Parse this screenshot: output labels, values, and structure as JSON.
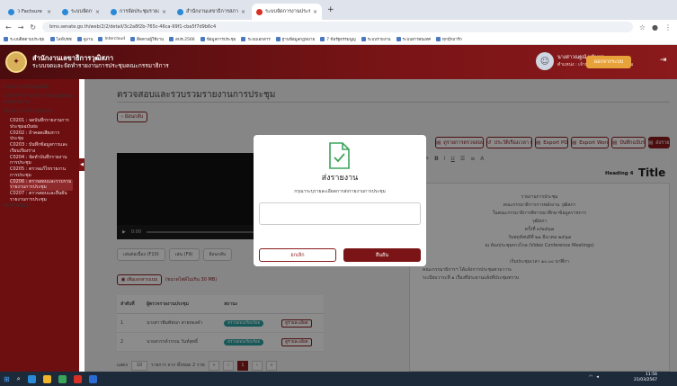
{
  "browser": {
    "tabs": [
      {
        "label": "ว Factsure",
        "color": "#2a8ad8"
      },
      {
        "label": "ระบบจัดการงานสำนักงาน ส่วน...",
        "color": "#2a8ad8"
      },
      {
        "label": "การจัดประชุมรายงานสำนักงาน",
        "color": "#2a8ad8"
      },
      {
        "label": "สำนักงานเลขาธิการสภาฯ",
        "color": "#2a8ad8"
      },
      {
        "label": "ระบบจัดการงานประชุม",
        "color": "#d93025"
      }
    ],
    "url": "bms.senate.go.th/web/2/2/detail/3c2a8f2b-765c-46ca-99f1-cba5f7d9b6c4",
    "bookmarks": [
      "ระบบติดตามประชุม",
      "ไลฟ์ปชช",
      "ดูงาน",
      "Intercloud",
      "ติดตามผู้ใช้งาน",
      "สปช.2566",
      "ข้อมูลการประชุม",
      "ระบบเอกสาร",
      "ฐานข้อมูลกฎหมาย",
      "7 ข้อรัฐธรรมนูญ",
      "ระบบรายงาน",
      "ระบบสารสนเทศ",
      "ทุกบุ๊กมาร์ก"
    ]
  },
  "header": {
    "org_line1": "สำนักงานเลขาธิการวุฒิสภา",
    "org_line2": "ระบบจดและจัดทำรายงานการประชุมคณะกรรมาธิการ",
    "user_name": "นางสาวณฐณ์ นพินทร",
    "user_role": "ตำแหน่ง : เจ้าหน้าที่รายงานการประชุม",
    "logout_label": "ออกจากระบบ"
  },
  "sidebar": {
    "items": [
      {
        "label": "การควบคุมข้อมูลหลัก",
        "type": "item"
      },
      {
        "label": "การจัดทำรายงานการประชุมคณะกรรมาธิการ",
        "type": "item"
      },
      {
        "label": "ขั้นตอนการดำเนินงาน",
        "type": "group"
      },
      {
        "label": "C0201 : จดบันทึกรายงานการประชุมฉบับย่อ",
        "type": "sub"
      },
      {
        "label": "C0202 : ถ้าคอดเสียงการประชุม",
        "type": "sub"
      },
      {
        "label": "C0203 : บันทึกข้อมูลการและเรียบเรียงร่าง",
        "type": "sub"
      },
      {
        "label": "C0204 : จัดทำบันทึกรายงานการประชุม",
        "type": "sub"
      },
      {
        "label": "C0205 : ตรวจแก้ไขรายงานการประชุม",
        "type": "sub"
      },
      {
        "label": "C0206 : ตรวจสอบและรวบรวมรายงานการประชุม",
        "type": "sub",
        "active": true
      },
      {
        "label": "C0207 : ตรวจสอบและยืนยันรายงานการประชุม",
        "type": "sub"
      },
      {
        "label": "จัดทำข้อมูล",
        "type": "item"
      }
    ]
  },
  "main": {
    "page_title": "ตรวจสอบและรวบรวมรายงานการประชุม",
    "back_label": "ย้อนกลับ",
    "toolbar": [
      {
        "label": "ดูรายการตรวจสอบ",
        "icon": "document-icon",
        "style": "outline"
      },
      {
        "label": "ประวัติเรื่องเวลา (5)",
        "icon": "history-icon",
        "style": "outline"
      },
      {
        "label": "Export PDF",
        "icon": "pdf-icon",
        "style": "outline"
      },
      {
        "label": "Export Word",
        "icon": "word-icon",
        "style": "outline"
      },
      {
        "label": "บันทึกฉบับร่าง",
        "icon": "save-icon",
        "style": "outline"
      },
      {
        "label": "ส่งรายงาน",
        "icon": "send-icon",
        "style": "filled"
      }
    ],
    "video_time": "0:00",
    "audio_buttons": [
      "เล่นต่อเนื่อง (F10)",
      "เล่น (F9)",
      "ย้อนกลับ"
    ],
    "add_file_label": "เพิ่มเอกสารแนบ",
    "file_hint": "(ขนาดไฟล์ไม่เกิน 30 MB)",
    "file_table": {
      "headers": [
        "ลำดับที่",
        "ผู้ตรวจรายงานประชุม",
        "สถานะ"
      ],
      "rows": [
        {
          "no": "1",
          "name": "นางสาวพิมพ์ชนก สายทองคำ",
          "status": "ตรวจสอบเรียบร้อย",
          "action": "ดูรายละเอียด"
        },
        {
          "no": "2",
          "name": "นายสวรรค์วรรณ วันท์สุทธิ์",
          "status": "ตรวจสอบเรียบร้อย",
          "action": "ดูรายละเอียด"
        }
      ]
    },
    "pager": {
      "page_size_label": "แสดง",
      "page_size": "10",
      "summary": "รายการ จาก ทั้งหมด 2 รายการ",
      "current_page": "1"
    }
  },
  "editor": {
    "heading_style": "Heading 4",
    "title_style": "Title",
    "doc_lines": [
      "รายงานการประชุม",
      "คณะกรรมาธิการการพลังงาน วุฒิสภา",
      "ในคณะกรรมาธิการพิจารณาศึกษาข้อมูลราชการ",
      "วุฒิสภา",
      "ครั้งที่ ๓/๒๕๖๗",
      "วันพฤหัสบดีที่ ๒๑ มีนาคม ๒๕๖๗",
      "ณ ห้องประชุมทางไกล (Video Conference Meetings)",
      "",
      "เริ่มประชุมเวลา ๑๐.๐๐ นาฬิกา",
      "คณะกรรมาธิการฯ ได้แจ้งการประชุมตามวาระ",
      "ระเบียบวาระที่ ๑ เรื่องที่ประธานแจ้งที่ประชุมทราบ"
    ]
  },
  "modal": {
    "title": "ส่งรายงาน",
    "description": "กรุณาระบุรายละเอียดการส่งรายงานการประชุม",
    "input_placeholder": "",
    "cancel_label": "ยกเลิก",
    "confirm_label": "ยืนยัน"
  },
  "taskbar": {
    "time": "11:56",
    "date": "21/03/2567"
  }
}
